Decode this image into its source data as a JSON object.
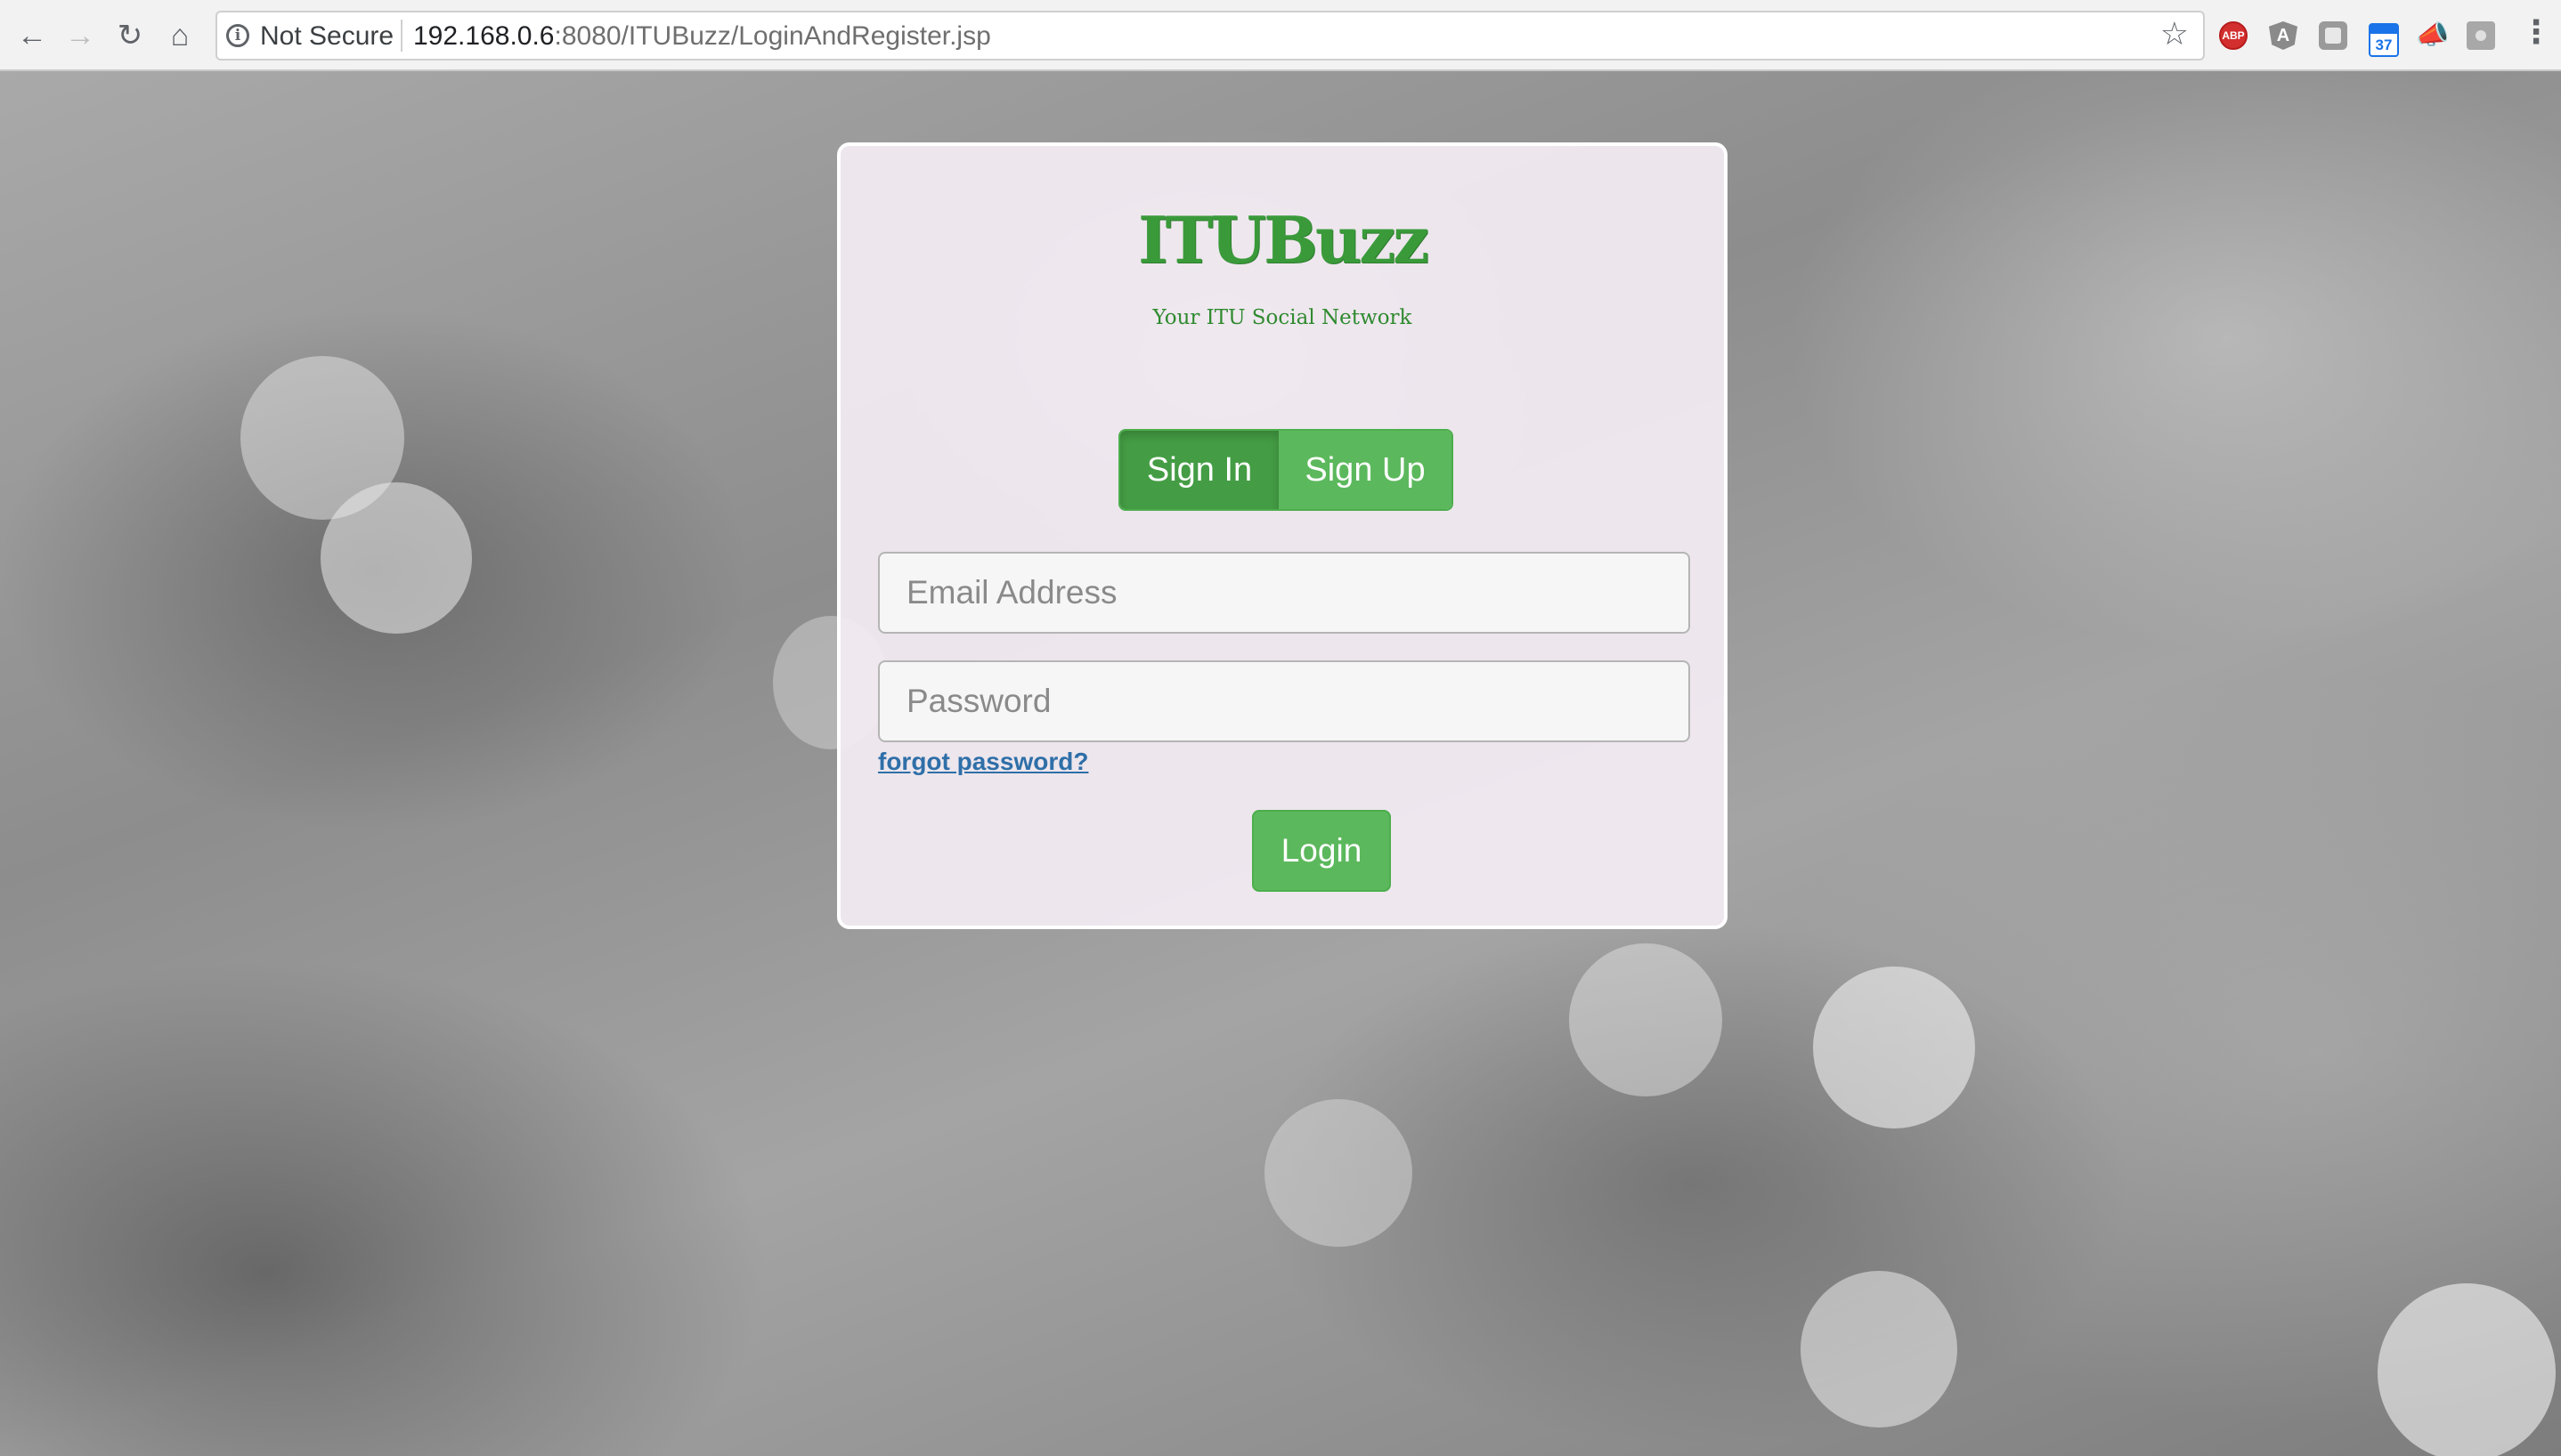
{
  "browser": {
    "security_label": "Not Secure",
    "url_host": "192.168.0.6",
    "url_rest": ":8080/ITUBuzz/LoginAndRegister.jsp",
    "icons": {
      "back": "arrow-left-icon",
      "forward": "arrow-right-icon",
      "reload": "reload-icon",
      "home": "home-icon",
      "info": "info-icon",
      "bookmark": "star-icon",
      "menu": "vertical-dots-icon"
    },
    "extensions": {
      "adblock_label": "ABP",
      "angular_label": "A",
      "calendar_badge": "37"
    }
  },
  "login_card": {
    "brand_name": "ITUBuzz",
    "tagline": "Your ITU Social Network",
    "tabs": {
      "sign_in": "Sign In",
      "sign_up": "Sign Up",
      "active": "sign_in"
    },
    "email": {
      "placeholder": "Email Address",
      "value": ""
    },
    "password": {
      "placeholder": "Password",
      "value": ""
    },
    "forgot_password": "forgot password?",
    "login_button": "Login"
  },
  "colors": {
    "brand_green": "#3a9a3a",
    "button_green": "#5cb85c",
    "active_tab_green": "#449d44",
    "link_blue": "#2f6fa8"
  }
}
